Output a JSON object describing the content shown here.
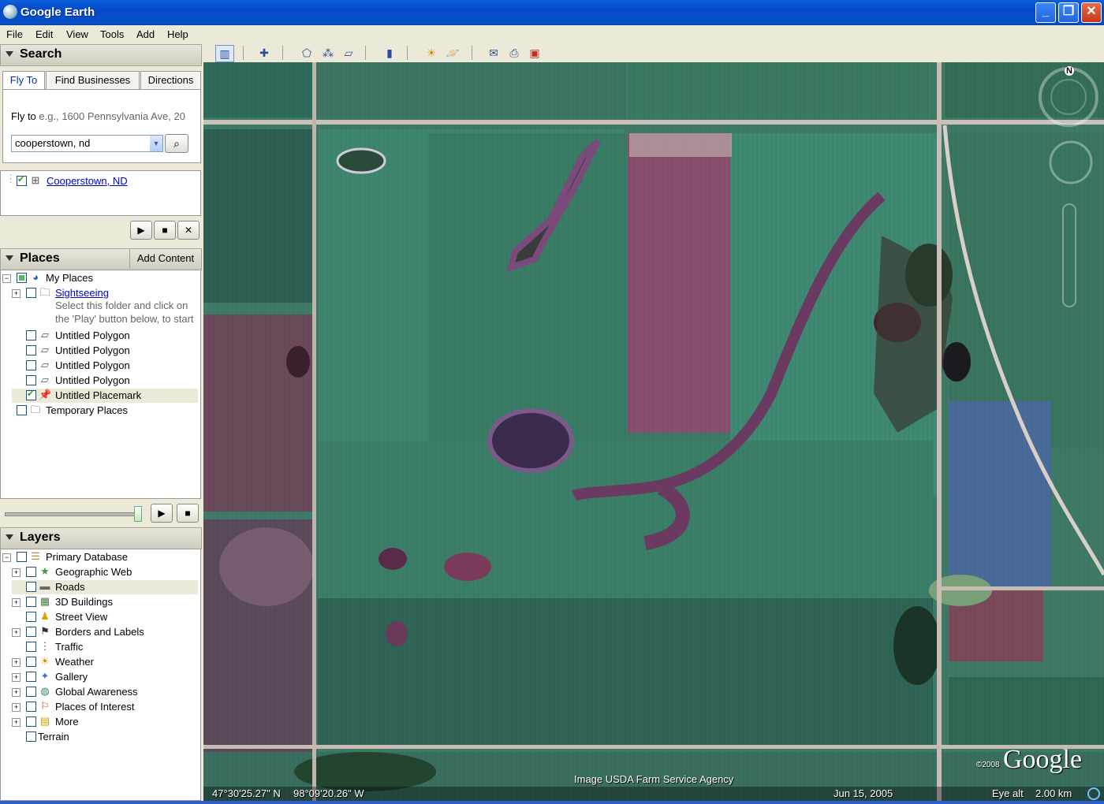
{
  "window": {
    "title": "Google Earth",
    "min": "_",
    "max": "❐",
    "close": "✕"
  },
  "menu": [
    "File",
    "Edit",
    "View",
    "Tools",
    "Add",
    "Help"
  ],
  "search": {
    "header": "Search",
    "tabs": [
      "Fly To",
      "Find Businesses",
      "Directions"
    ],
    "fly_to_label": "Fly to",
    "fly_to_hint": "e.g., 1600 Pennsylvania Ave, 20",
    "input_value": "cooperstown, nd",
    "result": "Cooperstown, ND"
  },
  "places": {
    "header": "Places",
    "add_content": "Add Content",
    "items": [
      {
        "label": "My Places"
      },
      {
        "label": "Sightseeing"
      },
      {
        "label": "Select this folder and click on"
      },
      {
        "label": "the 'Play' button below, to start"
      },
      {
        "label": "Untitled Polygon"
      },
      {
        "label": "Untitled Polygon"
      },
      {
        "label": "Untitled Polygon"
      },
      {
        "label": "Untitled Polygon"
      },
      {
        "label": "Untitled Placemark"
      },
      {
        "label": "Temporary Places"
      }
    ]
  },
  "layers": {
    "header": "Layers",
    "items": [
      {
        "label": "Primary Database"
      },
      {
        "label": "Geographic Web"
      },
      {
        "label": "Roads"
      },
      {
        "label": "3D Buildings"
      },
      {
        "label": "Street View"
      },
      {
        "label": "Borders and Labels"
      },
      {
        "label": "Traffic"
      },
      {
        "label": "Weather"
      },
      {
        "label": "Gallery"
      },
      {
        "label": "Global Awareness"
      },
      {
        "label": "Places of Interest"
      },
      {
        "label": "More"
      },
      {
        "label": "Terrain"
      }
    ]
  },
  "map": {
    "compass_n": "N",
    "attribution": "Image USDA Farm Service Agency",
    "copyright": "©2008",
    "logo": "Google",
    "lat": "47°30'25.27\" N",
    "lon": "98°09'20.26\" W",
    "date": "Jun 15, 2005",
    "eye_alt_label": "Eye alt",
    "eye_alt_value": "2.00 km"
  },
  "colors": {
    "titlebar": "#0554d8",
    "panel": "#ece9d8",
    "link": "#0000cc"
  }
}
